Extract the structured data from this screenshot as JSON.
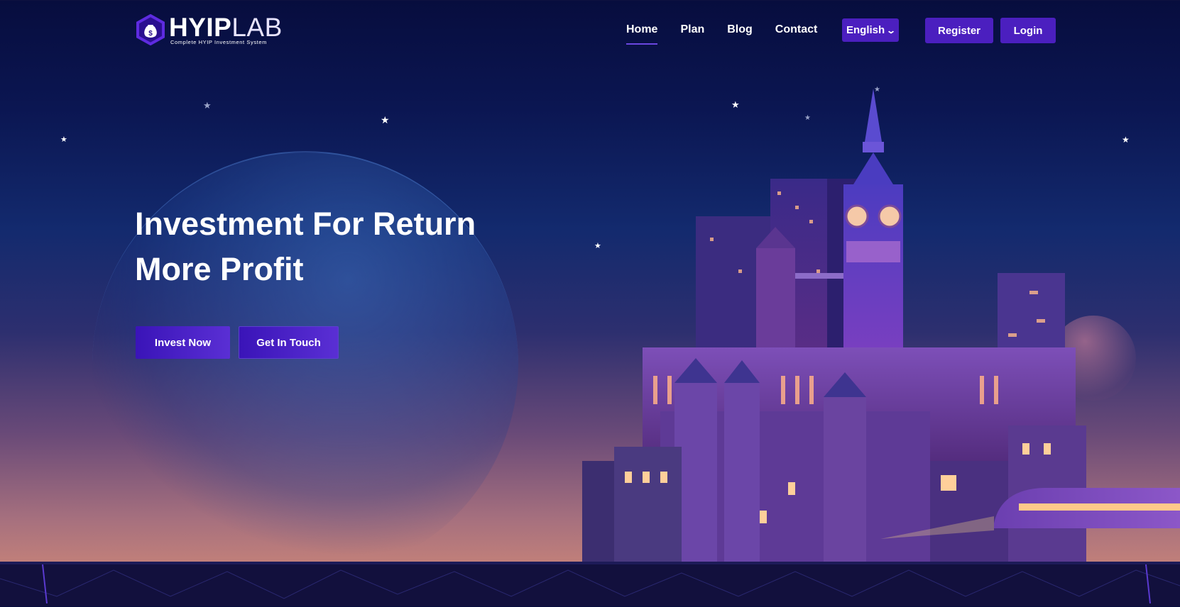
{
  "header": {
    "logo": {
      "bold": "HYIP",
      "thin": "LAB",
      "tagline": "Complete HYIP Investment System"
    },
    "nav": [
      {
        "label": "Home",
        "active": true
      },
      {
        "label": "Plan",
        "active": false
      },
      {
        "label": "Blog",
        "active": false
      },
      {
        "label": "Contact",
        "active": false
      }
    ],
    "language": "English",
    "register_label": "Register",
    "login_label": "Login"
  },
  "hero": {
    "title_line1": "Investment For Return",
    "title_line2": "More Profit",
    "invest_label": "Invest Now",
    "touch_label": "Get In Touch"
  },
  "colors": {
    "accent": "#4b1fbf",
    "bg_top": "#070d3e",
    "bg_bottom": "#c07f7a"
  },
  "icons": {
    "logo": "money-bag-icon",
    "dropdown": "chevron-down-icon",
    "stars": "star-icon"
  }
}
